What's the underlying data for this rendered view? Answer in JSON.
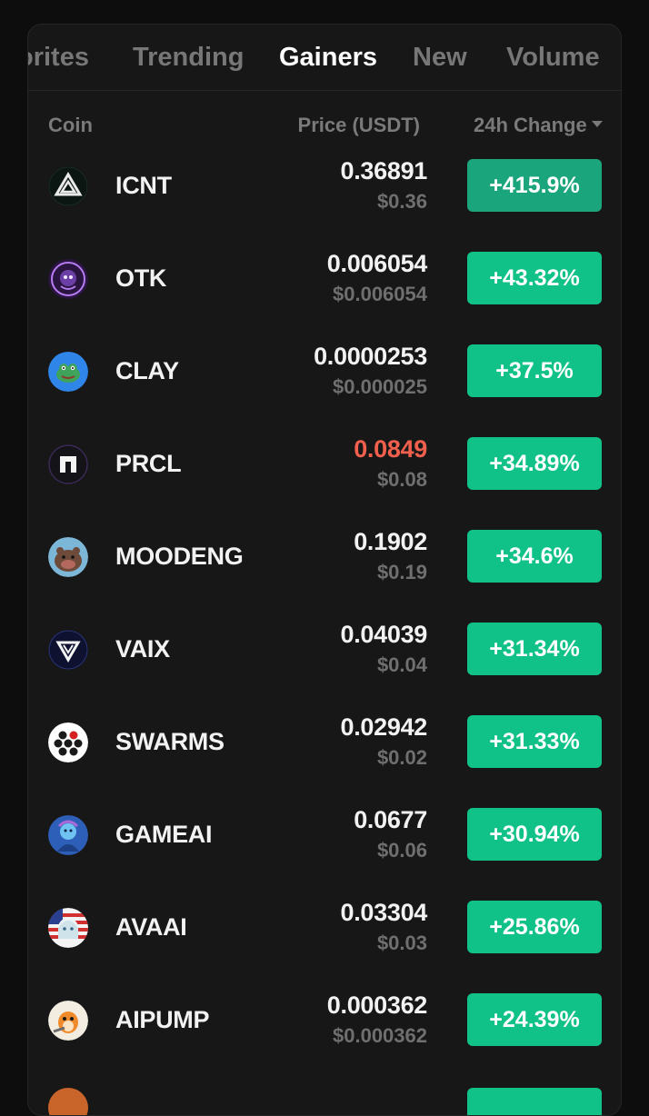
{
  "tabs": [
    {
      "label": "orites",
      "active": false
    },
    {
      "label": "Trending",
      "active": false
    },
    {
      "label": "Gainers",
      "active": true
    },
    {
      "label": "New",
      "active": false
    },
    {
      "label": "Volume",
      "active": false
    }
  ],
  "columns": {
    "coin": "Coin",
    "price": "Price (USDT)",
    "change": "24h Change"
  },
  "rows": [
    {
      "symbol": "ICNT",
      "price": "0.36891",
      "usd": "$0.36",
      "change": "+415.9%",
      "price_color": "#f2f2f2",
      "icon": "icnt-logo-icon"
    },
    {
      "symbol": "OTK",
      "price": "0.006054",
      "usd": "$0.006054",
      "change": "+43.32%",
      "price_color": "#f2f2f2",
      "icon": "otk-logo-icon"
    },
    {
      "symbol": "CLAY",
      "price": "0.0000253",
      "usd": "$0.000025",
      "change": "+37.5%",
      "price_color": "#f2f2f2",
      "icon": "clay-logo-icon"
    },
    {
      "symbol": "PRCL",
      "price": "0.0849",
      "usd": "$0.08",
      "change": "+34.89%",
      "price_color": "#f0604d",
      "icon": "prcl-logo-icon"
    },
    {
      "symbol": "MOODENG",
      "price": "0.1902",
      "usd": "$0.19",
      "change": "+34.6%",
      "price_color": "#f2f2f2",
      "icon": "moodeng-logo-icon"
    },
    {
      "symbol": "VAIX",
      "price": "0.04039",
      "usd": "$0.04",
      "change": "+31.34%",
      "price_color": "#f2f2f2",
      "icon": "vaix-logo-icon"
    },
    {
      "symbol": "SWARMS",
      "price": "0.02942",
      "usd": "$0.02",
      "change": "+31.33%",
      "price_color": "#f2f2f2",
      "icon": "swarms-logo-icon"
    },
    {
      "symbol": "GAMEAI",
      "price": "0.0677",
      "usd": "$0.06",
      "change": "+30.94%",
      "price_color": "#f2f2f2",
      "icon": "gameai-logo-icon"
    },
    {
      "symbol": "AVAAI",
      "price": "0.03304",
      "usd": "$0.03",
      "change": "+25.86%",
      "price_color": "#f2f2f2",
      "icon": "avaai-logo-icon"
    },
    {
      "symbol": "AIPUMP",
      "price": "0.000362",
      "usd": "$0.000362",
      "change": "+24.39%",
      "price_color": "#f2f2f2",
      "icon": "aipump-logo-icon"
    }
  ],
  "colors": {
    "background": "#0d0d0d",
    "panel": "#171717",
    "gain": "#10c287",
    "loss": "#f0604d",
    "muted": "#7a7a7a"
  }
}
